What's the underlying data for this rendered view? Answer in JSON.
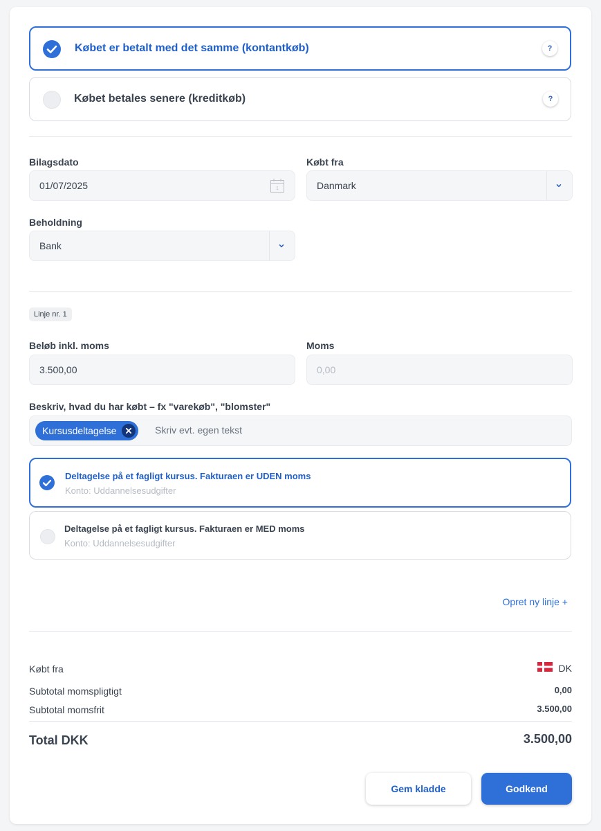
{
  "payment_options": [
    {
      "label": "Købet er betalt med det samme (kontantkøb)",
      "selected": true,
      "help": "?"
    },
    {
      "label": "Købet betales senere (kreditkøb)",
      "selected": false,
      "help": "?"
    }
  ],
  "fields": {
    "bilagsdato_label": "Bilagsdato",
    "bilagsdato_value": "01/07/2025",
    "calendar_day": "1",
    "koebt_fra_label": "Købt fra",
    "koebt_fra_value": "Danmark",
    "beholdning_label": "Beholdning",
    "beholdning_value": "Bank"
  },
  "line": {
    "badge": "Linje nr. 1",
    "amount_label": "Beløb inkl. moms",
    "amount_value": "3.500,00",
    "vat_label": "Moms",
    "vat_value": "0,00",
    "describe_label": "Beskriv, hvad du har købt – fx \"varekøb\", \"blomster\"",
    "chip": "Kursusdeltagelse",
    "describe_placeholder": "Skriv evt. egen tekst"
  },
  "suggestions": [
    {
      "title": "Deltagelse på et fagligt kursus. Fakturaen er UDEN moms",
      "account": "Konto: Uddannelsesudgifter",
      "selected": true
    },
    {
      "title": "Deltagelse på et fagligt kursus. Fakturaen er MED moms",
      "account": "Konto: Uddannelsesudgifter",
      "selected": false
    }
  ],
  "add_line_link": "Opret ny linje +",
  "summary": {
    "koebt_fra_label": "Købt fra",
    "country_code": "DK",
    "flag_colors": {
      "red": "#d7263d",
      "white": "#ffffff"
    },
    "subtotal_vat_label": "Subtotal momspligtigt",
    "subtotal_vat_value": "0,00",
    "subtotal_free_label": "Subtotal momsfrit",
    "subtotal_free_value": "3.500,00",
    "total_label": "Total DKK",
    "total_value": "3.500,00"
  },
  "buttons": {
    "save_draft": "Gem kladde",
    "approve": "Godkend"
  },
  "colors": {
    "accent": "#2e6fd8",
    "accent_dark": "#13357a",
    "text": "#3a4350",
    "muted": "#b5bbc3"
  }
}
